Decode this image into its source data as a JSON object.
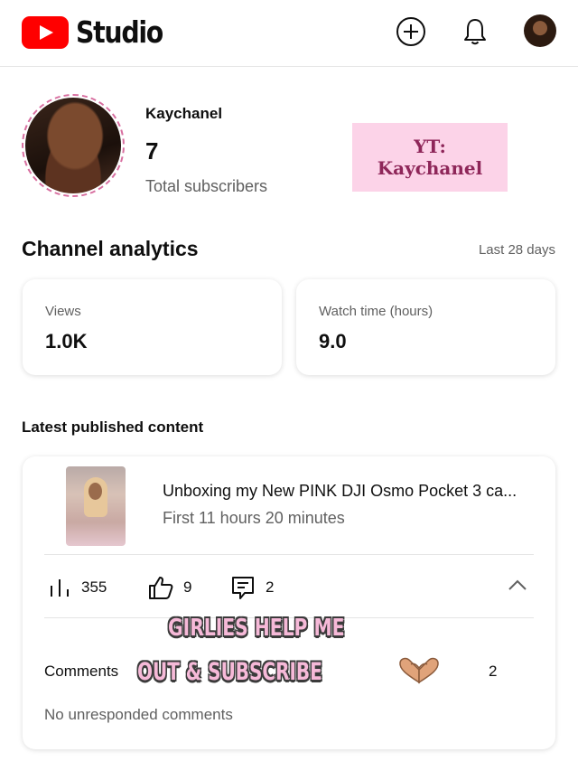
{
  "header": {
    "app_name": "Studio",
    "create_icon": "add-circle-icon",
    "notifications_icon": "bell-icon",
    "accent_color": "#ff0000"
  },
  "channel": {
    "name": "Kaychanel",
    "subscriber_count": "7",
    "subscriber_label": "Total subscribers",
    "promo_line1": "YT:",
    "promo_line2": "Kaychanel"
  },
  "analytics": {
    "title": "Channel analytics",
    "period": "Last 28 days",
    "views_label": "Views",
    "views_value": "1.0K",
    "watch_label": "Watch time (hours)",
    "watch_value": "9.0"
  },
  "latest": {
    "title": "Latest published content",
    "video_title": "Unboxing my New PINK DJI Osmo Pocket 3 ca...",
    "video_period": "First 11 hours 20 minutes",
    "views": "355",
    "likes": "9",
    "comments": "2",
    "comments_label": "Comments",
    "comments_count": "2",
    "no_unresponded": "No unresponded comments"
  },
  "overlay": {
    "line1": "GIRLIES HELP ME",
    "line2": "OUT & SUBSCRIBE"
  }
}
